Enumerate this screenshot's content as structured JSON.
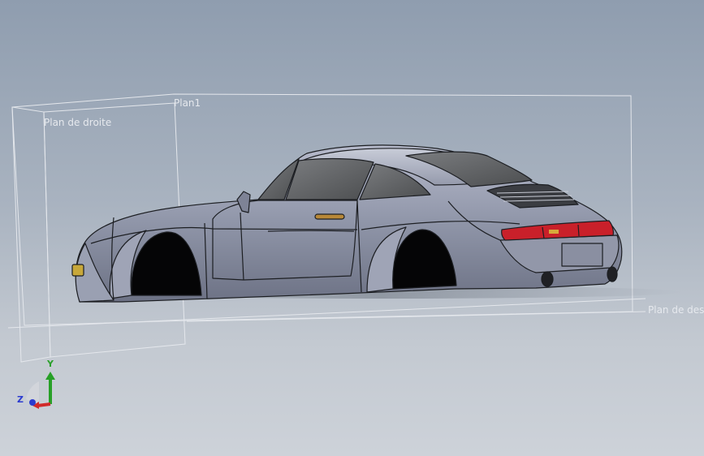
{
  "planes": {
    "plan1": "Plan1",
    "droite": "Plan de droite",
    "dessus": "Plan de dessus"
  },
  "triad": {
    "y_label": "Y",
    "z_label": "Z",
    "colors": {
      "x": "#d12a2a",
      "y": "#27a027",
      "z": "#2b3bd0"
    }
  },
  "model": {
    "body_color": "#8e93a5",
    "glass_color": "#5a5c5e",
    "taillight_color": "#c9202a",
    "indicator_color": "#c8a83a"
  }
}
